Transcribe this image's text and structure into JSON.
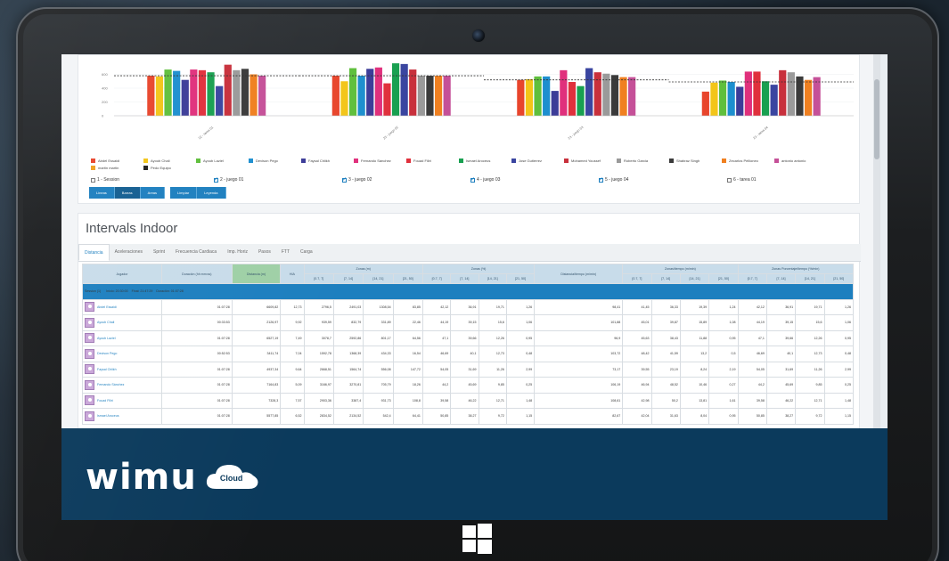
{
  "app": {
    "title": "Intervals Indoor",
    "brand": "wimu",
    "brand_sub": "Cloud"
  },
  "colors": {
    "accent": "#1d7fbf",
    "footer": "#0b3a5c",
    "players": [
      "#e8452c",
      "#f3c518",
      "#5fbf3c",
      "#1d8fcf",
      "#3c3c98",
      "#e0307c",
      "#e0303c",
      "#18a050",
      "#3a45a0",
      "#c8303c",
      "#9a9a9a",
      "#3a3a3a",
      "#f08020",
      "#c55098",
      "#f0a020",
      "#202020"
    ]
  },
  "chart_data": {
    "type": "bar",
    "ylim": [
      0,
      800
    ],
    "yticks": [
      "0",
      "200",
      "400",
      "600"
    ],
    "categories": [
      "22 - tarea 01",
      "23 - juego 02",
      "23 - juego 03",
      "23 - tarea 04"
    ],
    "averages": [
      580,
      580,
      520,
      490
    ],
    "values": [
      [
        580,
        570,
        670,
        650,
        520,
        670,
        660,
        630,
        430,
        740,
        660,
        680,
        600,
        580
      ],
      [
        580,
        500,
        690,
        580,
        680,
        700,
        470,
        760,
        750,
        670,
        580,
        580,
        580,
        580
      ],
      [
        520,
        530,
        570,
        570,
        360,
        660,
        490,
        430,
        690,
        630,
        610,
        590,
        560,
        560
      ],
      [
        350,
        480,
        510,
        490,
        420,
        640,
        640,
        500,
        450,
        660,
        630,
        570,
        520,
        560
      ]
    ]
  },
  "legend": [
    "Abdel Essaidi",
    "Ayoub Chali",
    "Ayoub Laziel",
    "Devison Pego",
    "Faysal Chlikh",
    "Fernando Sánchez",
    "Fouad Filiri",
    "Ismael Aroceus",
    "Jose Gutierrez",
    "Mohamed Youssef",
    "Roberto Garcia",
    "Shabraz Singh",
    "Zecarlos Pellioneo",
    "antonio antonio",
    "martin martin",
    "Pedo Equipo"
  ],
  "sessions": [
    {
      "label": "1 - Session",
      "checked": false
    },
    {
      "label": "2 - juego 01",
      "checked": true
    },
    {
      "label": "3 - juego 02",
      "checked": true
    },
    {
      "label": "4 - juego 03",
      "checked": true
    },
    {
      "label": "5 - juego 04",
      "checked": true
    },
    {
      "label": "6 - tarea 01",
      "checked": false
    }
  ],
  "controls": {
    "left": [
      "Lineas",
      "Barras",
      "Areas"
    ],
    "right": [
      "Limpiar",
      "Leyenda"
    ]
  },
  "tabs": [
    "Distancia",
    "Aceleraciones",
    "Sprint",
    "Frecuencia Cardiaca",
    "Imp. Horiz",
    "Pasos",
    "FTT",
    "Carga"
  ],
  "table": {
    "headers": {
      "player": "Jugador",
      "duration": "Duración (hh:mm:ss)",
      "distance": "Distancia (m)",
      "hia": "HIA",
      "zones_m": "Zonas (m)",
      "zones_pct": "Zonas (%)",
      "dist_time": "Distancia/tiempo (m/min)",
      "zones_time": "Zonas/tiempo (m/min)",
      "zones_pct_time": "Zonas Porcentaje/tiempo (%/min)"
    },
    "zone_labels": [
      "[0.7, 7]",
      "[7, 14]",
      "[14, 21]",
      "[21, 50]"
    ],
    "session": {
      "name": "Session (1)",
      "start": "Inicio: 20:30:00",
      "end": "Final: 21:47:29",
      "duration": "Duración: 01:07:28"
    },
    "rows": [
      [
        "Abdel Essaidi",
        "01:07:28",
        "6609,82",
        "12,73",
        "2796,5",
        "2491,03",
        "1308,54",
        "83,85",
        "42,12",
        "36,91",
        "19,71",
        "1,26",
        "98,41",
        "41,45",
        "36,33",
        "19,39",
        "1,24",
        "42,12",
        "36,91",
        "19,71",
        "1,26"
      ],
      [
        "Ayoub Chali",
        "00:33:53",
        "2126,97",
        "9,92",
        "939,59",
        "832,79",
        "331,89",
        "22,46",
        "44,19",
        "39,15",
        "15,6",
        "1,06",
        "101,88",
        "45,01",
        "39,87",
        "15,89",
        "1,08",
        "44,19",
        "39,15",
        "15,6",
        "1,06"
      ],
      [
        "Ayoub Laziel",
        "01:07:28",
        "6527,19",
        "7,49",
        "3078,7",
        "2592,86",
        "801,17",
        "64,56",
        "47,1",
        "39,66",
        "12,26",
        "0,95",
        "96,9",
        "45,63",
        "38,43",
        "11,88",
        "0,95",
        "47,1",
        "39,66",
        "12,26",
        "0,95"
      ],
      [
        "Devison Pego",
        "00:52:53",
        "3411,74",
        "7,04",
        "1592,78",
        "1368,39",
        "434,33",
        "16,54",
        "46,69",
        "40,1",
        "12,73",
        "0,48",
        "103,72",
        "48,42",
        "41,59",
        "13,2",
        "0,5",
        "46,69",
        "40,1",
        "12,73",
        "0,48"
      ],
      [
        "Faysal Chlikh",
        "01:07:28",
        "4937,34",
        "9,64",
        "2668,51",
        "1564,74",
        "556,08",
        "147,72",
        "54,05",
        "31,69",
        "11,26",
        "2,99",
        "73,17",
        "39,55",
        "23,19",
        "8,24",
        "2,19",
        "54,05",
        "31,69",
        "11,26",
        "2,99"
      ],
      [
        "Fernando Sánchez",
        "01:07:28",
        "7164,83",
        "5,09",
        "3166,97",
        "3270,81",
        "705,79",
        "18,26",
        "44,2",
        "45,69",
        "9,85",
        "0,25",
        "106,19",
        "46,94",
        "48,52",
        "10,46",
        "0,27",
        "44,2",
        "45,69",
        "9,85",
        "0,25"
      ],
      [
        "Fouad Filiri",
        "01:07:28",
        "7328,3",
        "7,57",
        "2903,36",
        "3387,4",
        "931,73",
        "108,8",
        "39,58",
        "46,22",
        "12,71",
        "1,48",
        "108,61",
        "42,98",
        "50,2",
        "13,81",
        "1,61",
        "39,58",
        "46,22",
        "12,71",
        "1,48"
      ],
      [
        "Ismael Aroceus",
        "01:07:28",
        "5577,85",
        "6,52",
        "2834,52",
        "2134,52",
        "542,4",
        "64,41",
        "50,85",
        "38,27",
        "9,72",
        "1,15",
        "82,67",
        "42,04",
        "31,63",
        "8,04",
        "0,95",
        "50,85",
        "38,27",
        "9,72",
        "1,15"
      ]
    ]
  }
}
